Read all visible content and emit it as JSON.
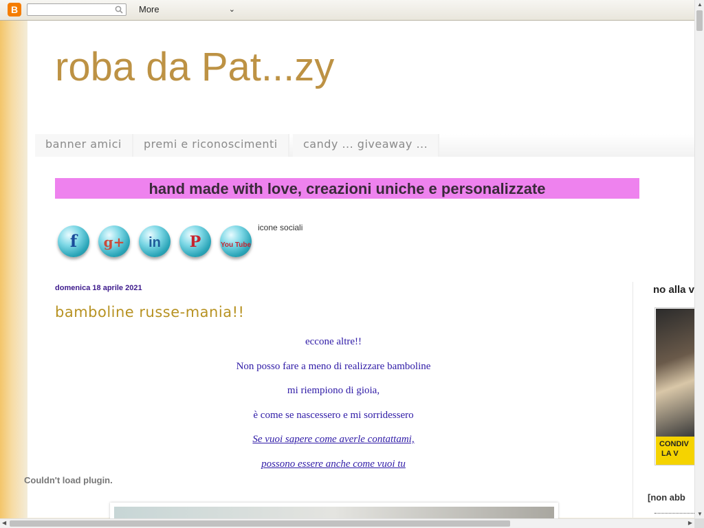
{
  "navbar": {
    "logo": "B",
    "search_placeholder": "",
    "more_label": "More",
    "more_chevron": "⌄"
  },
  "blog": {
    "title": "roba da Pat...zy"
  },
  "tabs": [
    {
      "label": "banner amici"
    },
    {
      "label": "premi e riconoscimenti"
    },
    {
      "label": "candy ... giveaway ..."
    }
  ],
  "banner": {
    "text": "hand made with love, creazioni uniche e personalizzate",
    "color": "#ee82ee"
  },
  "social": {
    "icons": [
      {
        "icon": "facebook-icon",
        "glyph": "f"
      },
      {
        "icon": "google-plus-icon",
        "glyph": "g+"
      },
      {
        "icon": "linkedin-icon",
        "glyph": "in"
      },
      {
        "icon": "pinterest-icon",
        "glyph": "P"
      },
      {
        "icon": "youtube-icon",
        "glyph": "You Tube"
      }
    ],
    "label": "icone sociali"
  },
  "post": {
    "date": "domenica 18 aprile 2021",
    "title": "bamboline russe-mania!!",
    "lines": [
      "eccone altre!!",
      "Non posso fare a meno di realizzare bamboline",
      "mi riempiono di gioia,",
      "è come se nascessero e mi sorridessero"
    ],
    "links": [
      "Se vuoi sapere come averle contattami,",
      "possono essere anche come vuoi tu"
    ],
    "plugin_message": "Couldn't load plugin."
  },
  "sidebar": {
    "widget_title": "no alla v",
    "image_band": "CONDIV\n LA V",
    "alt_text": "[non abb"
  },
  "colors": {
    "title": "#bd9244",
    "post_text": "#2e1aa6",
    "post_title": "#b79222"
  }
}
